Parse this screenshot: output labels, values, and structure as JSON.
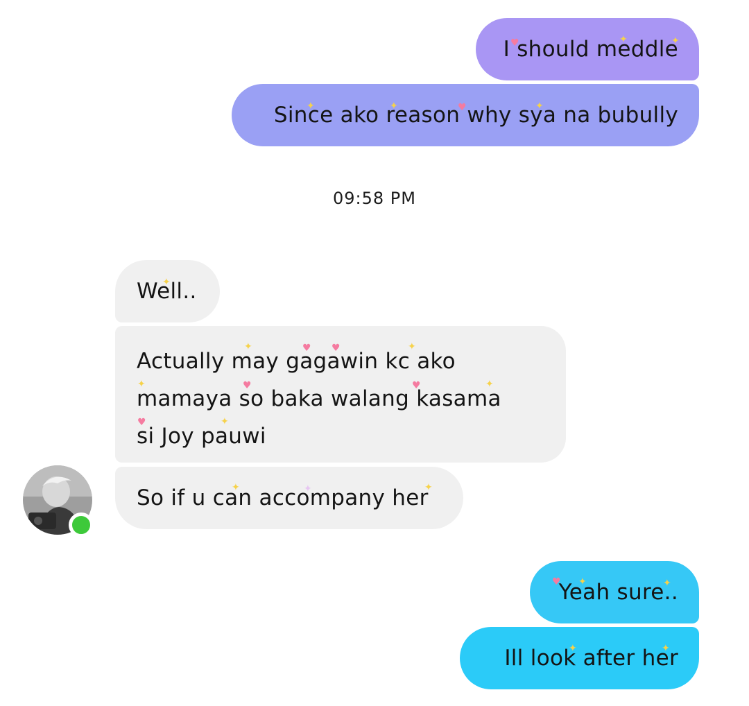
{
  "messages": {
    "sent_1": "I should meddle",
    "sent_2": "Since ako reason why sya na bubully",
    "timestamp": "09:58 PM",
    "received_1": "Well..",
    "received_2_lines": [
      "Actually may gagawin kc ako",
      "mamaya so baka walang kasama",
      "si Joy pauwi"
    ],
    "received_3": "So if u can accompany her",
    "sent_3": "Yeah sure..",
    "sent_4": "Ill look after her"
  },
  "contact": {
    "status": "online",
    "status_color": "#3dc93a"
  },
  "colors": {
    "sent_bubble_top": "#a996f4",
    "sent_bubble_bottom": "#9aa0f4",
    "received_bubble": "#f0f0f0",
    "sent_bubble_blue": "#2bcbf8"
  }
}
